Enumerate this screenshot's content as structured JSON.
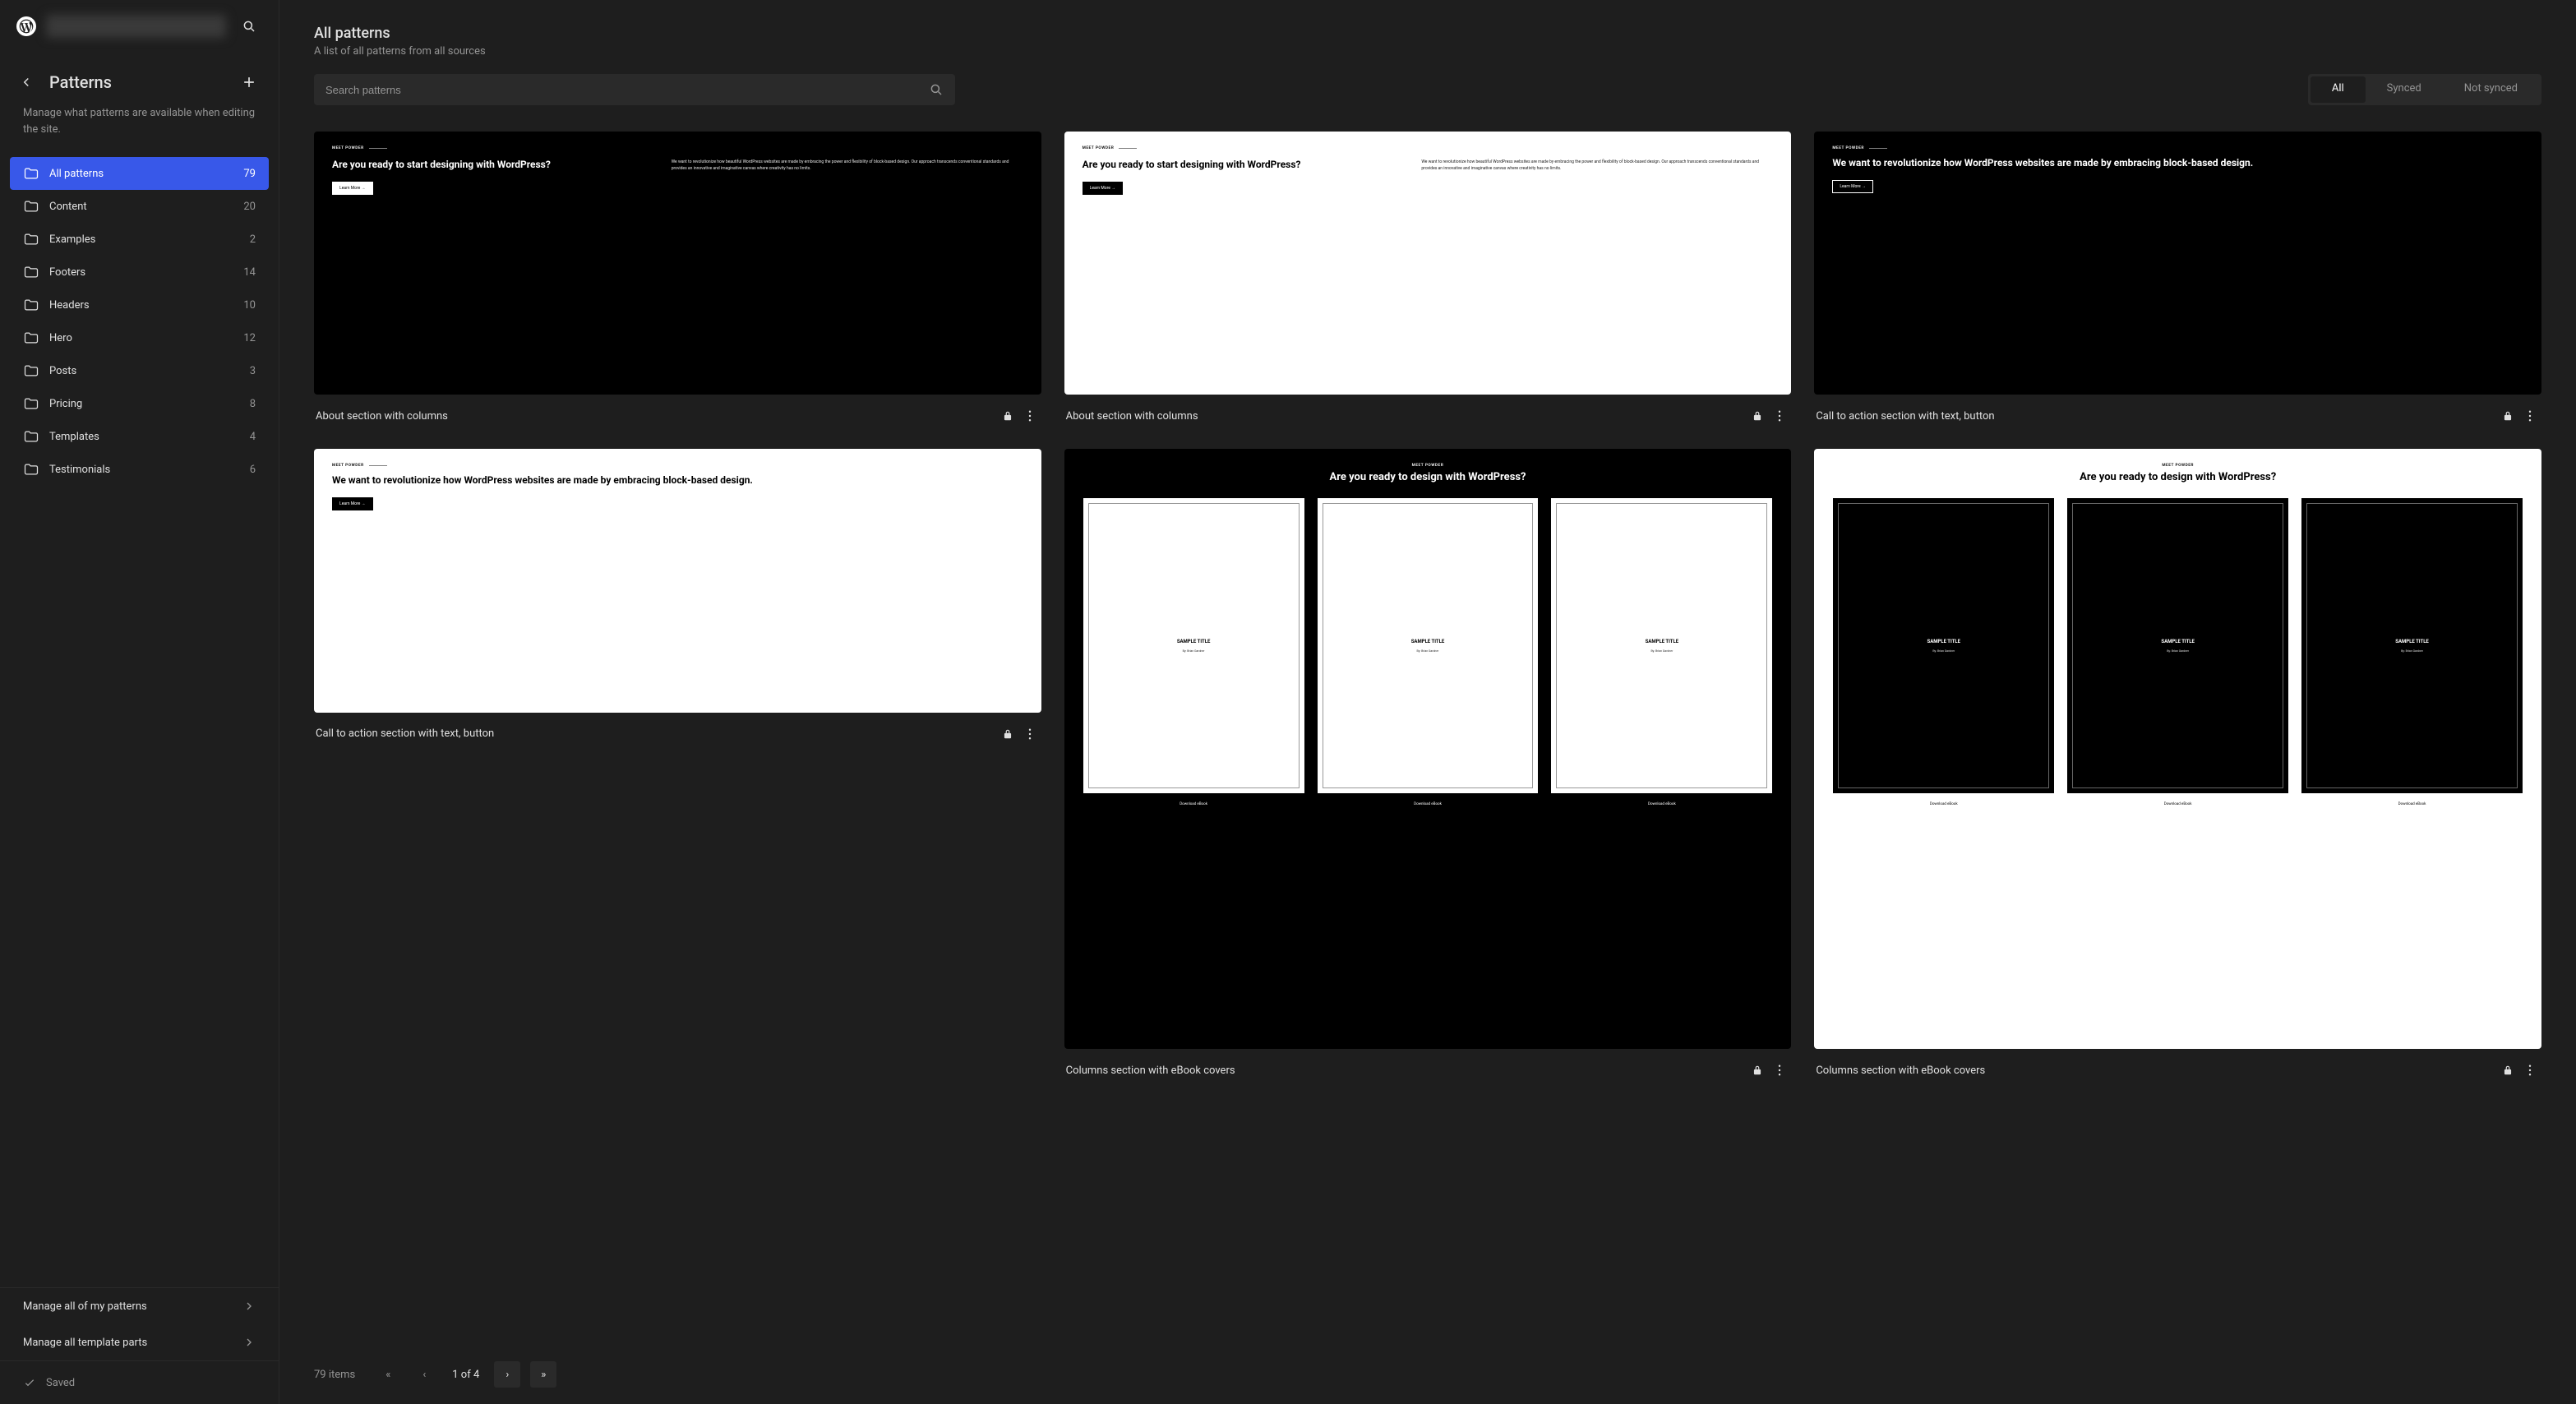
{
  "sidebar": {
    "panel_title": "Patterns",
    "panel_desc": "Manage what patterns are available when editing the site.",
    "items": [
      {
        "label": "All patterns",
        "count": "79",
        "active": true
      },
      {
        "label": "Content",
        "count": "20"
      },
      {
        "label": "Examples",
        "count": "2"
      },
      {
        "label": "Footers",
        "count": "14"
      },
      {
        "label": "Headers",
        "count": "10"
      },
      {
        "label": "Hero",
        "count": "12"
      },
      {
        "label": "Posts",
        "count": "3"
      },
      {
        "label": "Pricing",
        "count": "8"
      },
      {
        "label": "Templates",
        "count": "4"
      },
      {
        "label": "Testimonials",
        "count": "6"
      }
    ],
    "manage_patterns": "Manage all of my patterns",
    "manage_parts": "Manage all template parts",
    "saved": "Saved"
  },
  "header": {
    "title": "All patterns",
    "subtitle": "A list of all patterns from all sources"
  },
  "search": {
    "placeholder": "Search patterns"
  },
  "filters": {
    "all": "All",
    "synced": "Synced",
    "not_synced": "Not synced"
  },
  "preview_text": {
    "meet": "MEET POWDER",
    "hero_heading": "Are you ready to start designing with WordPress?",
    "hero_para": "We want to revolutionize how beautiful WordPress websites are made by embracing the power and flexibility of block-based design. Our approach transcends conventional standards and provides an innovative and imaginative canvas where creativity has no limits.",
    "cta_heading": "We want to revolutionize how WordPress websites are made by embracing block-based design.",
    "learn_more": "Learn More →",
    "covers_heading": "Are you ready to design with WordPress?",
    "sample_title": "SAMPLE TITLE",
    "by": "By: Brian Gardner",
    "download": "Download eBook"
  },
  "cards": [
    {
      "title": "About section with columns"
    },
    {
      "title": "About section with columns"
    },
    {
      "title": "Call to action section with text, button"
    },
    {
      "title": "Call to action section with text, button"
    },
    {
      "title": "Columns section with eBook covers"
    },
    {
      "title": "Columns section with eBook covers"
    }
  ],
  "pagination": {
    "total": "79 items",
    "first": "«",
    "prev": "‹",
    "pos": "1 of 4",
    "next": "›",
    "last": "»"
  }
}
